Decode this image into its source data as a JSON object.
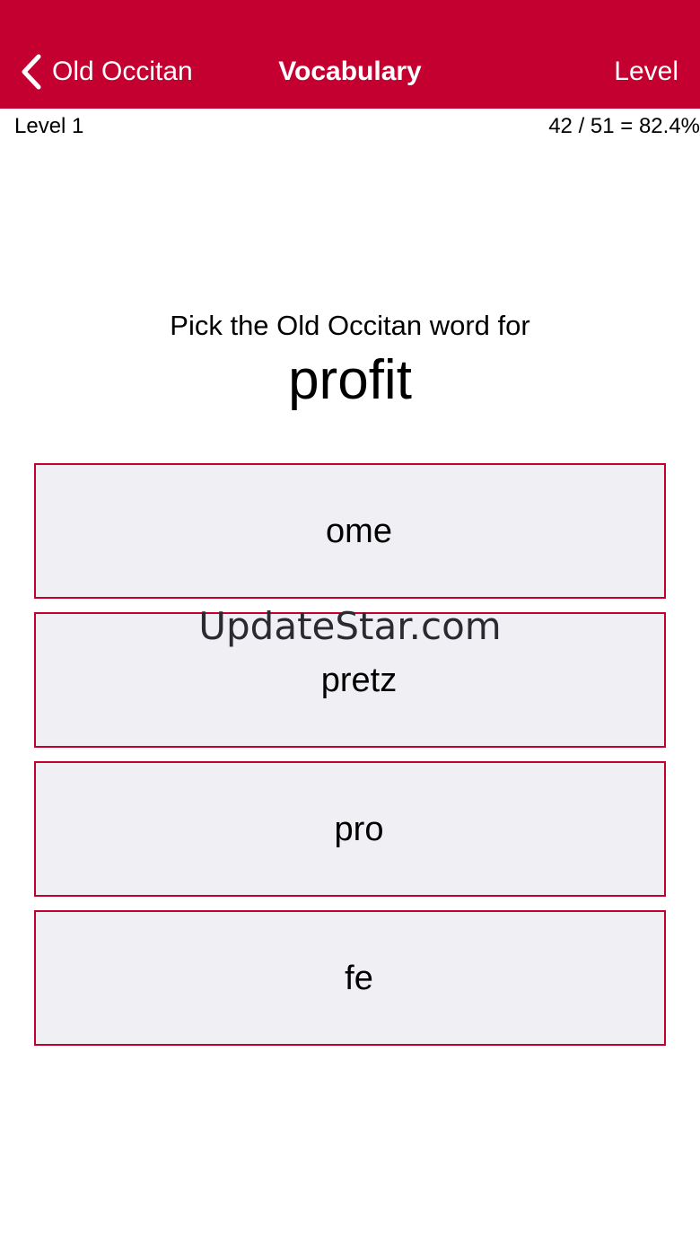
{
  "colors": {
    "accent": "#c40031",
    "option_background": "#efeff4",
    "text": "#000000",
    "navbar_text": "#ffffff"
  },
  "navbar": {
    "back_label": "Old Occitan",
    "back_icon": "chevron-left-icon",
    "title": "Vocabulary",
    "right_label": "Level"
  },
  "status": {
    "level": "Level 1",
    "score": "42 / 51 = 82.4%"
  },
  "question": {
    "prompt": "Pick the Old Occitan word for",
    "word": "profit"
  },
  "options": [
    {
      "label": "ome"
    },
    {
      "label": "pretz"
    },
    {
      "label": "pro"
    },
    {
      "label": "fe"
    }
  ],
  "watermark": "UpdateStar.com"
}
